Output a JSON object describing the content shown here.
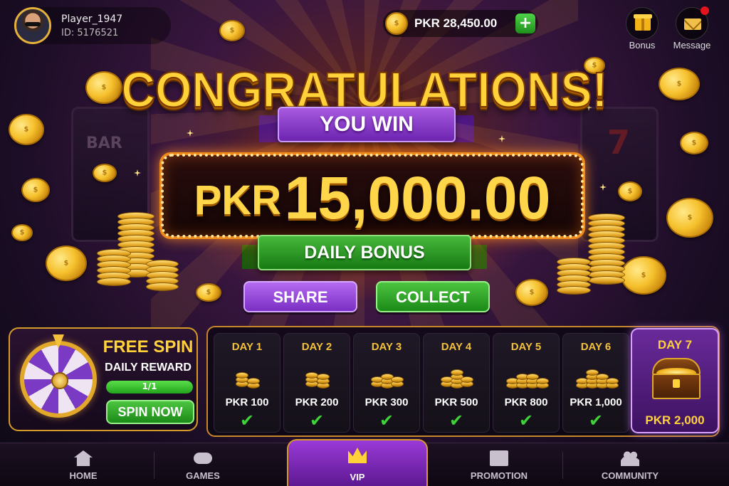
{
  "player": {
    "name": "Player_1947",
    "id": "ID: 5176521"
  },
  "balance": {
    "value": "PKR 28,450.00",
    "add_label": "+"
  },
  "top_buttons": {
    "bonus": "Bonus",
    "message": "Message",
    "message_has_notification": true
  },
  "reels": {
    "left_symbol": "BAR",
    "right_symbol": "7"
  },
  "headline": {
    "title": "CONGRATULATIONS!",
    "subtitle": "YOU WIN"
  },
  "prize": {
    "currency": "PKR",
    "amount": "15,000.00",
    "label": "DAILY BONUS"
  },
  "actions": {
    "share": "SHARE",
    "collect": "COLLECT"
  },
  "free_spin": {
    "title": "FREE SPIN",
    "subtitle": "DAILY REWARD",
    "progress_text": "1/1",
    "progress_fraction": 1.0,
    "button": "SPIN NOW"
  },
  "days": [
    {
      "label": "DAY 1",
      "amount": "PKR 100",
      "check": "✔"
    },
    {
      "label": "DAY 2",
      "amount": "PKR 200",
      "check": "✔"
    },
    {
      "label": "DAY 3",
      "amount": "PKR 300",
      "check": "✔"
    },
    {
      "label": "DAY 4",
      "amount": "PKR 500",
      "check": "✔"
    },
    {
      "label": "DAY 5",
      "amount": "PKR 800",
      "check": "✔"
    },
    {
      "label": "DAY 6",
      "amount": "PKR 1,000",
      "check": "✔"
    }
  ],
  "day7": {
    "label": "DAY 7",
    "amount": "PKR 2,000"
  },
  "nav": {
    "home": "HOME",
    "games": "GAMES",
    "vip": "VIP",
    "promotion": "PROMOTION",
    "community": "COMMUNITY",
    "active": "vip"
  },
  "colors": {
    "gold": "#ffd23a",
    "purple": "#7a2fc4",
    "green": "#1b8a18",
    "check_green": "#3ed13a"
  }
}
